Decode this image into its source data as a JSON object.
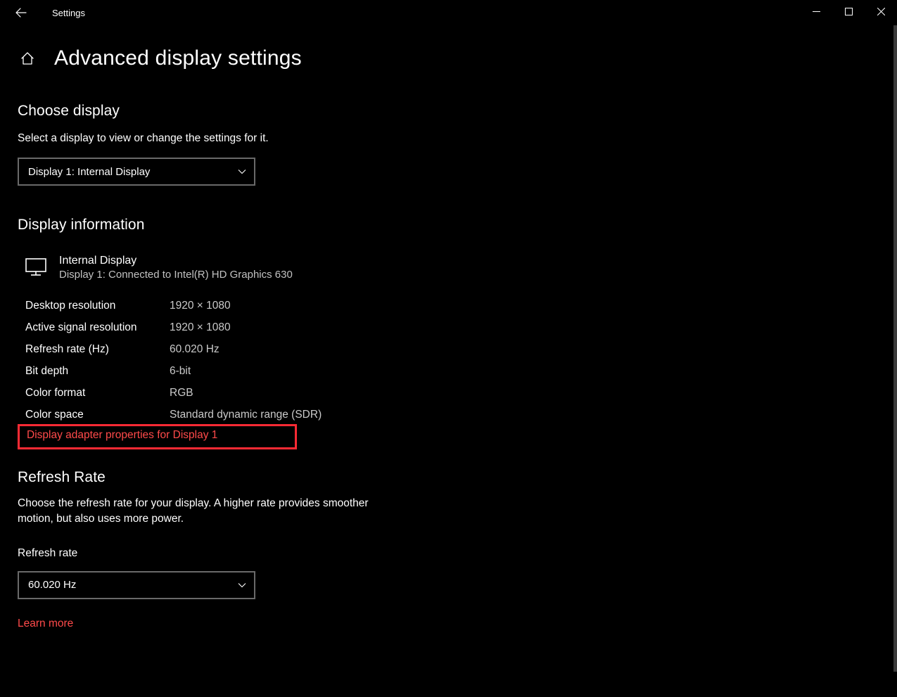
{
  "window": {
    "title": "Settings"
  },
  "page": {
    "title": "Advanced display settings"
  },
  "choose_display": {
    "heading": "Choose display",
    "description": "Select a display to view or change the settings for it.",
    "selected": "Display 1: Internal Display"
  },
  "display_information": {
    "heading": "Display information",
    "monitor_name": "Internal Display",
    "connection": "Display 1: Connected to Intel(R) HD Graphics 630",
    "rows": [
      {
        "label": "Desktop resolution",
        "value": "1920 × 1080"
      },
      {
        "label": "Active signal resolution",
        "value": "1920 × 1080"
      },
      {
        "label": "Refresh rate (Hz)",
        "value": "60.020 Hz"
      },
      {
        "label": "Bit depth",
        "value": "6-bit"
      },
      {
        "label": "Color format",
        "value": "RGB"
      },
      {
        "label": "Color space",
        "value": "Standard dynamic range (SDR)"
      }
    ],
    "adapter_link": "Display adapter properties for Display 1"
  },
  "refresh_rate": {
    "heading": "Refresh Rate",
    "description": "Choose the refresh rate for your display. A higher rate provides smoother motion, but also uses more power.",
    "field_label": "Refresh rate",
    "selected": "60.020 Hz",
    "learn_more": "Learn more"
  }
}
